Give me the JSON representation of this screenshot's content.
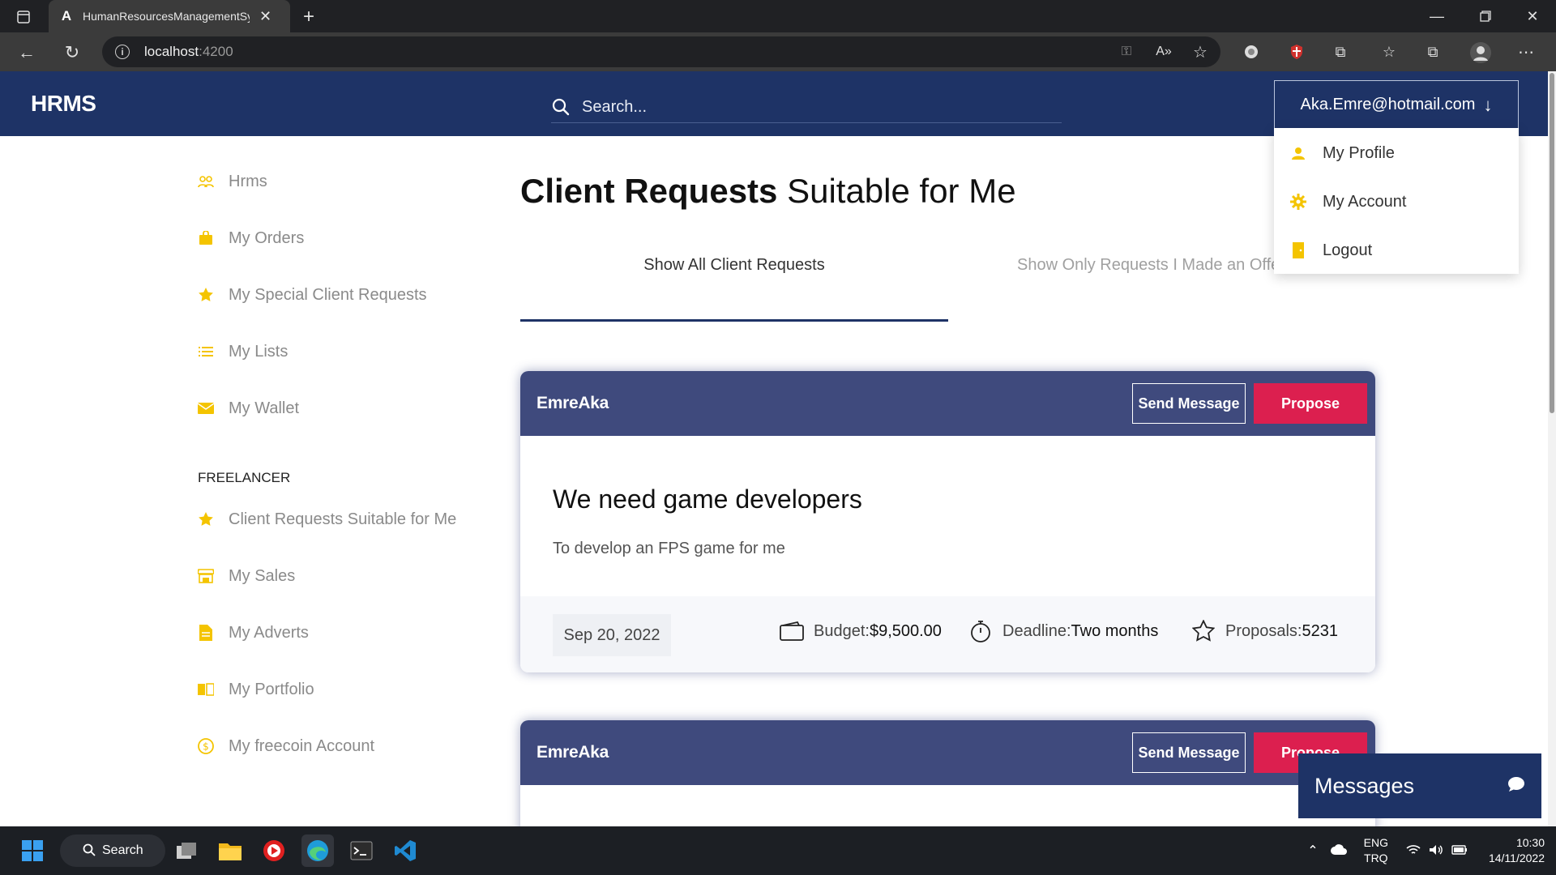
{
  "browser": {
    "tab_title": "HumanResourcesManagementSy",
    "url_host": "localhost",
    "url_port": ":4200"
  },
  "header": {
    "brand": "HRMS",
    "search_placeholder": "Search...",
    "user_email": "Aka.Emre@hotmail.com",
    "user_arrow": "↓"
  },
  "user_menu": {
    "items": [
      {
        "label": "My Profile",
        "icon": "person-icon"
      },
      {
        "label": "My Account",
        "icon": "gear-icon"
      },
      {
        "label": "Logout",
        "icon": "door-icon"
      }
    ]
  },
  "sidebar": {
    "items": [
      {
        "label": "Hrms",
        "icon": "users-icon"
      },
      {
        "label": "My Orders",
        "icon": "bag-icon"
      },
      {
        "label": "My Special Client Requests",
        "icon": "star-icon"
      },
      {
        "label": "My Lists",
        "icon": "list-icon"
      },
      {
        "label": "My Wallet",
        "icon": "envelope-icon"
      }
    ],
    "section": "FREELANCER",
    "freelancer_items": [
      {
        "label": "Client Requests Suitable for Me",
        "icon": "star-icon"
      },
      {
        "label": "My Sales",
        "icon": "store-icon"
      },
      {
        "label": "My Adverts",
        "icon": "document-icon"
      },
      {
        "label": "My Portfolio",
        "icon": "book-icon"
      },
      {
        "label": "My freecoin Account",
        "icon": "coin-icon"
      }
    ]
  },
  "main": {
    "title_strong": "Client Requests",
    "title_rest": " Suitable for Me",
    "tabs": [
      {
        "label": "Show All Client Requests",
        "active": true
      },
      {
        "label": "Show Only Requests I Made an Offer",
        "active": false
      }
    ]
  },
  "cards": [
    {
      "user": "EmreAka",
      "send_label": "Send Message",
      "propose_label": "Propose",
      "title": "We need game developers",
      "description": "To develop an FPS game for me",
      "date": "Sep 20, 2022",
      "budget_label": "Budget:",
      "budget_value": "$9,500.00",
      "deadline_label": "Deadline:",
      "deadline_value": "Two months",
      "proposals_label": "Proposals:",
      "proposals_value": "5231"
    },
    {
      "user": "EmreAka",
      "send_label": "Send Message",
      "propose_label": "Propose"
    }
  ],
  "messages_widget": {
    "label": "Messages"
  },
  "taskbar": {
    "search_label": "Search",
    "lang_top": "ENG",
    "lang_bottom": "TRQ",
    "time": "10:30",
    "date": "14/11/2022"
  },
  "colors": {
    "header_navy": "#1e3366",
    "card_header": "#3f4a7d",
    "propose_red": "#dc1f4f",
    "icon_yellow": "#f4c400"
  }
}
